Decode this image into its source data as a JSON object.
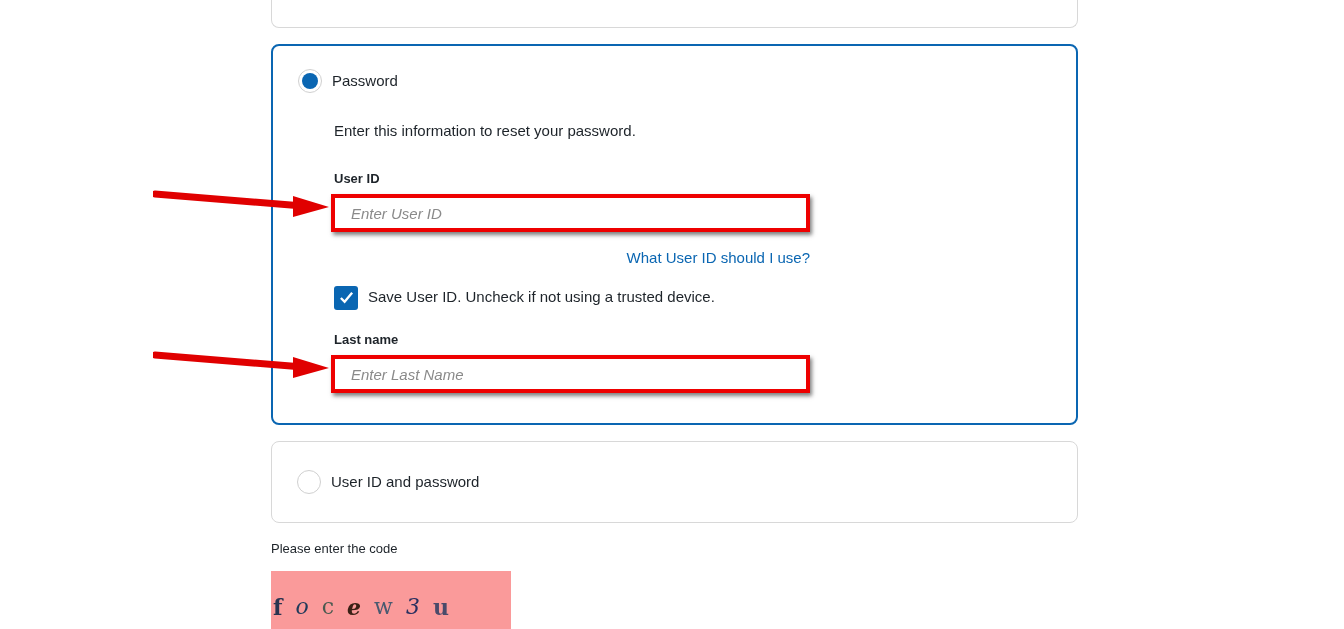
{
  "options": [
    {
      "kind": "form",
      "label": "Password",
      "selected": true,
      "intro": "Enter this information to reset your password.",
      "fields": [
        {
          "label": "User ID",
          "placeholder": "Enter User ID",
          "highlighted": true
        },
        {
          "label": "Last name",
          "placeholder": "Enter Last Name",
          "highlighted": true
        }
      ],
      "help_link": "What User ID should I use?",
      "save_checkbox": {
        "label": "Save User ID. Uncheck if not using a trusted device.",
        "checked": true
      }
    },
    {
      "kind": "simple",
      "label": "User ID and password",
      "selected": false
    }
  ],
  "captcha": {
    "label": "Please enter the code",
    "characters": [
      {
        "char": "f",
        "color": "#2a3450"
      },
      {
        "char": "o",
        "color": "#1f3a5a"
      },
      {
        "char": "c",
        "color": "#4a5a50"
      },
      {
        "char": "e",
        "color": "#3a2015"
      },
      {
        "char": "w",
        "color": "#4a5a70"
      },
      {
        "char": "3",
        "color": "#2a3060"
      },
      {
        "char": "u",
        "color": "#4a4a6a"
      }
    ]
  }
}
